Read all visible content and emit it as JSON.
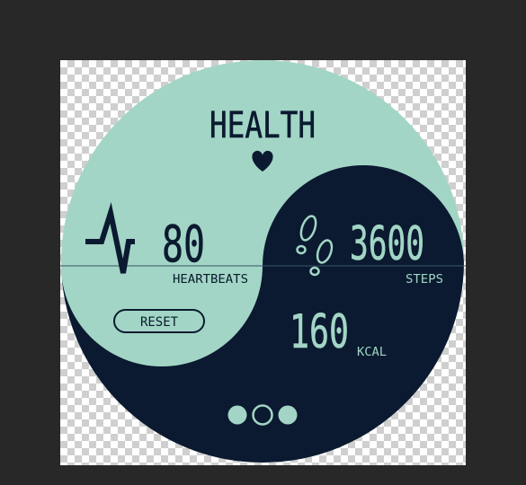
{
  "title": "HEALTH",
  "heart": {
    "value": "80",
    "unit": "HEARTBEATS"
  },
  "steps": {
    "value": "3600",
    "unit": "STEPS"
  },
  "calories": {
    "value": "160",
    "unit": "KCAL"
  },
  "reset_label": "RESET",
  "page_indicator": {
    "pages": 3,
    "active_index": 1
  },
  "colors": {
    "mint": "#a2d5c5",
    "navy": "#0b1a30",
    "backdrop": "#282828"
  },
  "icons": {
    "heart": "heart-icon",
    "pulse": "pulse-icon",
    "steps": "footprints-icon"
  }
}
